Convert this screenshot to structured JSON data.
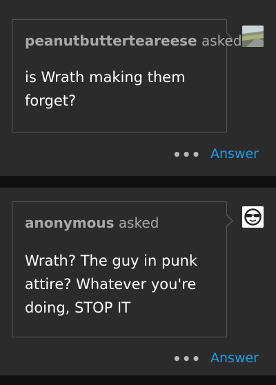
{
  "posts": [
    {
      "asker": "peanutbutterteareese",
      "asked_word": "asked",
      "question": "is Wrath making them forget?",
      "avatar_icon": "landscape-photo-avatar-icon",
      "more_icon": "•••",
      "answer_label": "Answer"
    },
    {
      "asker": "anonymous",
      "asked_word": "asked",
      "question": "Wrath? The guy in punk attire? Whatever you're doing, STOP IT",
      "avatar_icon": "sunglasses-face-avatar-icon",
      "more_icon": "•••",
      "answer_label": "Answer"
    }
  ],
  "colors": {
    "background": "#111111",
    "card": "#2b2b2b",
    "accent": "#1e9fe6"
  }
}
